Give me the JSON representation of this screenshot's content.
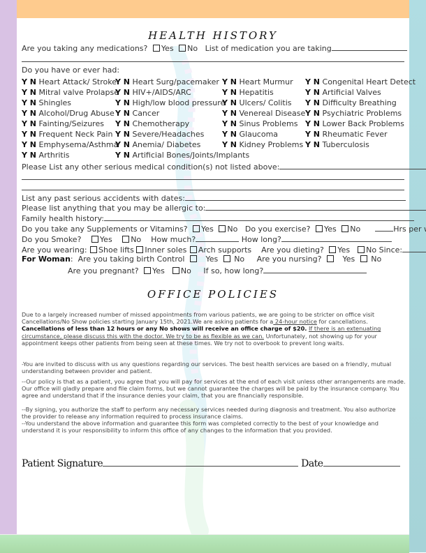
{
  "health_history": {
    "title": "HEALTH HISTORY",
    "medications_question": "Are you taking any medications?",
    "yes": "Yes",
    "no": "No",
    "medication_list_label": "List of medication you are taking",
    "conditions_intro": "Do you have or ever had:",
    "yn_label": "Y N",
    "conditions": [
      [
        "Heart Attack/ Stroke",
        "Mitral valve Prolapse",
        "Shingles",
        "Alcohol/Drug Abuse",
        "Fainting/Seizures",
        "Frequent Neck Pain",
        "Emphysema/Asthma",
        "Arthritis"
      ],
      [
        "Heart Surg/pacemaker",
        "HIV+/AIDS/ARC",
        "High/low blood pressure",
        "Cancer",
        "Chemotherapy",
        "Severe/Headaches",
        "Anemia/ Diabetes",
        "Artificial Bones/Joints/Implants"
      ],
      [
        "Heart Murmur",
        "Hepatitis",
        "Ulcers/ Colitis",
        "Venereal Disease",
        "Sinus Problems",
        "Glaucoma",
        "Kidney Problems"
      ],
      [
        "Congenital Heart Detect",
        "Artificial Valves",
        "Difficulty Breathing",
        "Psychiatric Problems",
        "Lower Back Problems",
        "Rheumatic Fever",
        "Tuberculosis"
      ]
    ],
    "other_conditions_label": "Please List any other serious medical condition(s) not listed above:",
    "accidents_label": "List any past serious accidents with dates:",
    "allergies_label": "Please list anything that you may be allergic to:",
    "family_history_label": "Family health history:",
    "supplements_question": "Do you take any Supplements or Vitamins?",
    "exercise_question": "Do you exercise?",
    "hrs_per_week": "Hrs per week",
    "smoke_question": "Do you Smoke?",
    "how_much": "How much?",
    "how_long": "How long?",
    "wearing_label": "Are you wearing:",
    "shoe_lifts": "Shoe lifts",
    "inner_soles": "Inner soles",
    "arch_supports": "Arch supports",
    "dieting_question": "Are you dieting?",
    "no_since": "No Since:",
    "for_woman": "For Woman",
    "birth_control_question": "Are you taking birth Control",
    "nursing_question": "Are you nursing?",
    "pregnant_question": "Are you pregnant?",
    "if_so_how_long": "If so, how long?"
  },
  "office_policies": {
    "title": "OFFICE POLICIES",
    "p1_a": "Due to a largely increased number of missed appointments from various patients, we are going to be stricter on office visit Cancellations/No Show policies starting January 15th, 2021.We are asking patients for a",
    "p1_notice": " 24-hour notice",
    "p1_b": " for cancellations. ",
    "p1_bold": "Cancellations of less than 12 hours or any No shows will receive an office charge of $20.",
    "p1_c": " ",
    "p1_underline": "If there is an extenuating circumstance, please discuss this with the doctor. We try to be as flexible as we can.",
    "p1_d": "  Unfortunately, not showing up for your appointment keeps other patients from being seen at these times. We try not to overbook to prevent long waits.",
    "p2": "-You are invited to discuss with us any questions regarding our services. The best health services are based on   a friendly, mutual understanding between provider and patient.",
    "p3": "--Our policy is that as a patient, you agree that you will pay for services at the end of each visit unless other arrangements are made. Our office will gladly prepare and file claim forms, but we cannot guarantee the charges will be paid by the insurance company. You agree and understand that if the insurance denies your claim, that you are financially responsible.",
    "p4": "--By signing, you authorize the staff to perform any necessary services needed during diagnosis and treatment. You also authorize the provider to release any information required to process insurance claims.",
    "p5": "--You understand the above information and guarantee this form was completed correctly to the best of your knowledge and understand it is your responsibility to inform this office of any changes to the information that you provided."
  },
  "signature": {
    "patient_signature": "Patient Signature",
    "date": "Date"
  },
  "colors": {
    "left_strip": "#d9c2e4",
    "right_strip": "#b0dde3",
    "top_band": "#fecb8e",
    "bottom_band": "#b9e9bd"
  }
}
